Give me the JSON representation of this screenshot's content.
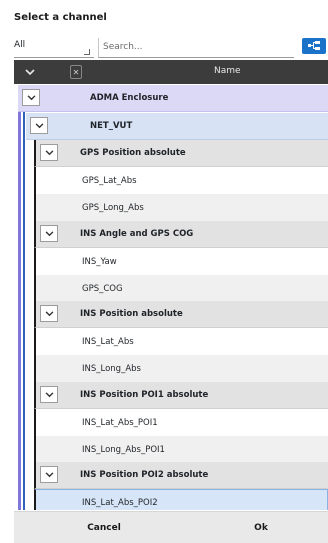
{
  "dialog": {
    "title": "Select a channel",
    "filter_value": "All",
    "search_placeholder": "Search...",
    "tree_button_icon": "hierarchy-icon"
  },
  "columns": {
    "name": "Name"
  },
  "tree": {
    "root": "ADMA Enclosure",
    "group": "NET_VUT",
    "sections": [
      {
        "label": "GPS Position absolute",
        "items": [
          "GPS_Lat_Abs",
          "GPS_Long_Abs"
        ]
      },
      {
        "label": "INS Angle and GPS COG",
        "items": [
          "INS_Yaw",
          "GPS_COG"
        ]
      },
      {
        "label": "INS Position absolute",
        "items": [
          "INS_Lat_Abs",
          "INS_Long_Abs"
        ]
      },
      {
        "label": "INS Position POI1 absolute",
        "items": [
          "INS_Lat_Abs_POI1",
          "INS_Long_Abs_POI1"
        ]
      },
      {
        "label": "INS Position POI2 absolute",
        "items": [
          "INS_Lat_Abs_POI2"
        ]
      }
    ],
    "selected_item": "INS_Lat_Abs_POI2"
  },
  "footer": {
    "cancel_label": "Cancel",
    "ok_label": "Ok"
  },
  "colors": {
    "accent": "#1a73c8",
    "header_bg": "#3c3c3c",
    "level0_bg": "#dcd9f7",
    "level1_bg": "#d7e3f5",
    "section_bg": "#e2e2e2",
    "selected_bg": "#d6e5f7"
  }
}
